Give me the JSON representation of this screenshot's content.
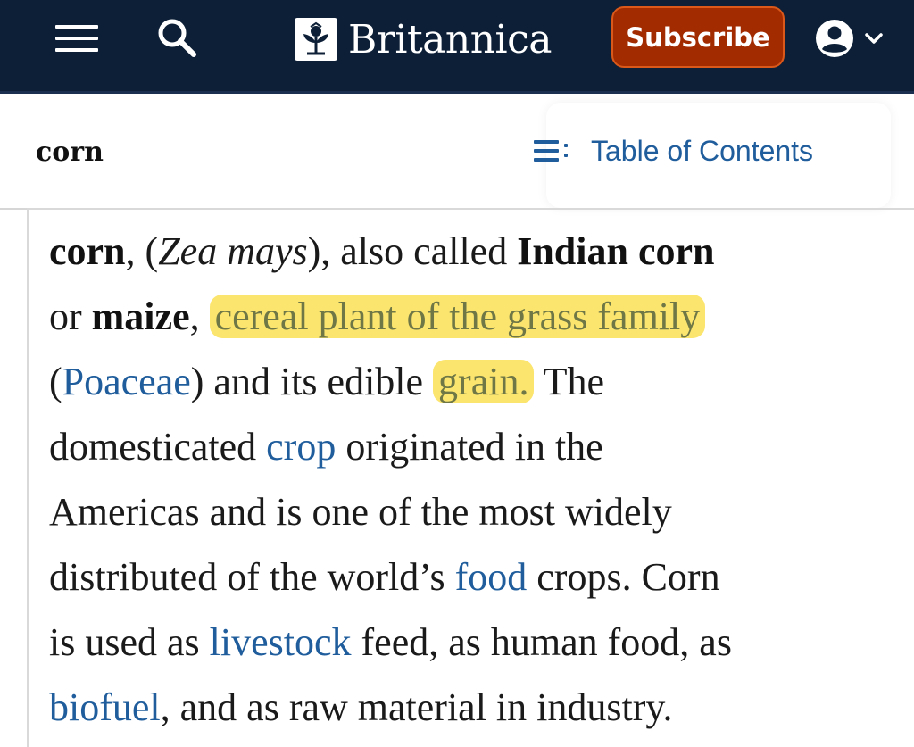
{
  "header": {
    "brand": "Britannica",
    "subscribe_label": "Subscribe",
    "icons": [
      "menu-icon",
      "search-icon",
      "britannica-thistle-icon",
      "account-icon",
      "chevron-down-icon"
    ],
    "colors": {
      "bar": "#0c1f36",
      "subscribe": "#a22b00",
      "link": "#1f5d9c",
      "highlight": "#fbe56f"
    }
  },
  "subheader": {
    "topic": "corn",
    "toc_label": "Table of Contents"
  },
  "article": {
    "l1": {
      "a": "corn",
      "b": ", (",
      "c": "Zea mays",
      "d": "), also called ",
      "e": "Indian corn"
    },
    "l2": {
      "a": "or ",
      "b": "maize",
      "c": ", ",
      "d": "cereal plant of the grass family"
    },
    "l3": {
      "a": "(",
      "b": "Poaceae",
      "c": ") and its edible ",
      "d": "grain.",
      "e": " The"
    },
    "l4": {
      "a": "domesticated ",
      "b": "crop",
      "c": " originated in the"
    },
    "l5": {
      "a": "Americas and is one of the most widely"
    },
    "l6": {
      "a": "distributed of the world’s ",
      "b": "food",
      "c": " crops. Corn"
    },
    "l7": {
      "a": "is used as ",
      "b": "livestock",
      "c": " feed, as human food, as"
    },
    "l8": {
      "a": "biofuel",
      "b": ", and as raw material in industry."
    }
  }
}
